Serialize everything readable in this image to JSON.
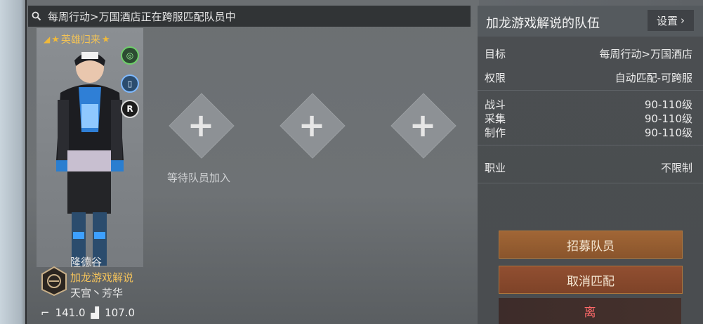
{
  "search": {
    "status_text": "每周行动>万国酒店正在跨服匹配队员中"
  },
  "player": {
    "title": "英雄归来",
    "name": "隆德谷",
    "guild": "加龙游戏解说",
    "server": "天宫丶芳华",
    "stat_attack": "141.0",
    "stat_defense": "107.0",
    "side_icon_r": "R"
  },
  "slots": {
    "waiting_text": "等待队员加入"
  },
  "team_panel": {
    "title": "加龙游戏解说的队伍",
    "settings_label": "设置",
    "rows": [
      {
        "label": "目标",
        "value": "每周行动>万国酒店"
      },
      {
        "label": "权限",
        "value": "自动匹配-可跨服"
      },
      {
        "label": "战斗",
        "value": "90-110级"
      },
      {
        "label": "采集",
        "value": "90-110级"
      },
      {
        "label": "制作",
        "value": "90-110级"
      },
      {
        "label": "职业",
        "value": "不限制"
      }
    ]
  },
  "actions": {
    "recruit_label": "招募队员",
    "cancel_label": "取消匹配",
    "leave_label": "离"
  },
  "colors": {
    "accent_gold": "#f1c15b",
    "button_bronze": "#a16636",
    "leave_red": "#ff6a6a"
  }
}
